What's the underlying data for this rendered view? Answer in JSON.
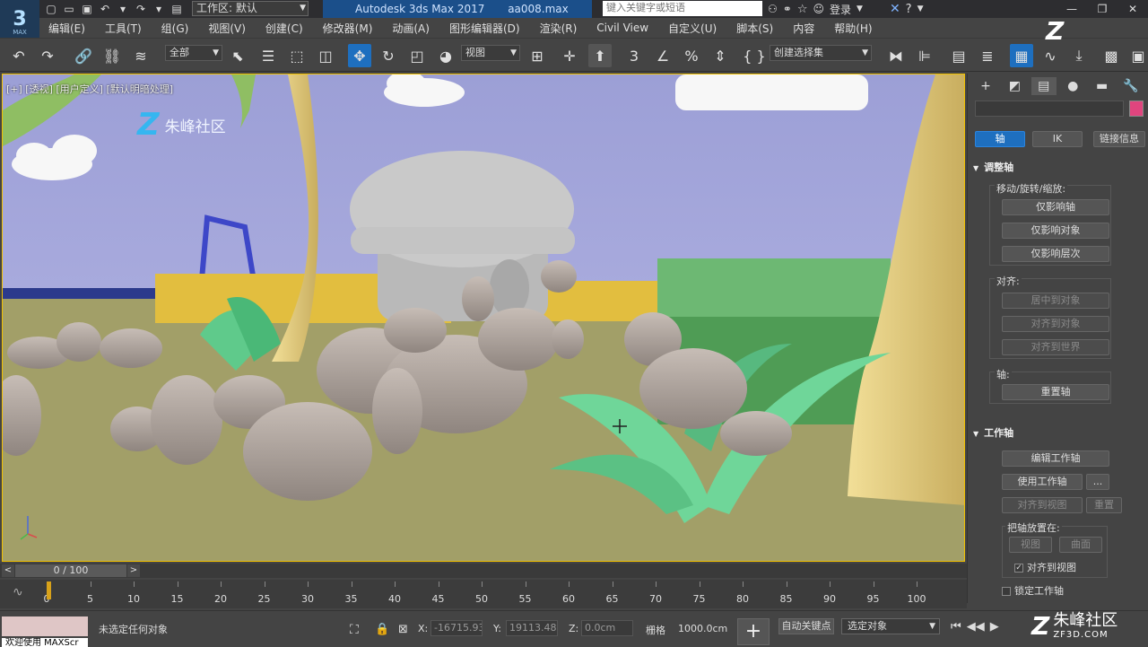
{
  "titlebar": {
    "app_logo_text": "3",
    "app_logo_sub": "MAX",
    "workspace_label": "工作区: 默认",
    "title": "Autodesk 3ds Max 2017",
    "filename": "aa008.max",
    "search_placeholder": "键入关键字或短语",
    "login": "登录"
  },
  "menu": [
    "编辑(E)",
    "工具(T)",
    "组(G)",
    "视图(V)",
    "创建(C)",
    "修改器(M)",
    "动画(A)",
    "图形编辑器(D)",
    "渲染(R)",
    "Civil View",
    "自定义(U)",
    "脚本(S)",
    "内容",
    "帮助(H)"
  ],
  "toolbar": {
    "filter_dd": "全部",
    "refcoord_dd": "视图",
    "selset_dd": "创建选择集"
  },
  "viewport": {
    "label": "[+] [透视] [用户定义] [默认明暗处理]",
    "watermark": "朱峰社区",
    "watermark_z": "Z"
  },
  "command_panel": {
    "tabs": [
      "create-icon",
      "modify-icon",
      "hierarchy-icon",
      "motion-icon",
      "display-icon",
      "utilities-icon"
    ],
    "name_color": "#e0457e",
    "mode_buttons": [
      "轴",
      "IK",
      "链接信息"
    ],
    "section_adjust": "调整轴",
    "group_move": "移动/旋转/缩放:",
    "btn_affect_pivot": "仅影响轴",
    "btn_affect_object": "仅影响对象",
    "btn_affect_hierarchy": "仅影响层次",
    "group_align": "对齐:",
    "btn_center": "居中到对象",
    "btn_align_object": "对齐到对象",
    "btn_align_world": "对齐到世界",
    "group_pivot": "轴:",
    "btn_reset": "重置轴",
    "section_workpivot": "工作轴",
    "btn_edit_wp": "编辑工作轴",
    "btn_use_wp": "使用工作轴",
    "btn_more": "...",
    "btn_align_view": "对齐到视图",
    "btn_reset2": "重置",
    "group_place": "把轴放置在:",
    "btn_view": "视图",
    "btn_surface": "曲面",
    "chk_align_view": "对齐到视图",
    "chk_lock_wp": "锁定工作轴"
  },
  "timeline": {
    "slider_label": "0 / 100",
    "ticks": [
      "0",
      "5",
      "10",
      "15",
      "20",
      "25",
      "30",
      "35",
      "40",
      "45",
      "50",
      "55",
      "60",
      "65",
      "70",
      "75",
      "80",
      "85",
      "90",
      "95",
      "100"
    ]
  },
  "statusbar": {
    "maxscript_label": "欢迎使用 MAXScr",
    "status_msg": "未选定任何对象",
    "x_label": "X:",
    "x_value": "-16715.93",
    "y_label": "Y:",
    "y_value": "19113.486",
    "z_label": "Z:",
    "z_value": "0.0cm",
    "grid_label": "栅格",
    "grid_value": "1000.0cm",
    "autokey": "自动关键点",
    "selection_dd": "选定对象"
  },
  "corner_watermark": {
    "z": "Z",
    "title": "朱峰社区",
    "url": "ZF3D.COM"
  }
}
